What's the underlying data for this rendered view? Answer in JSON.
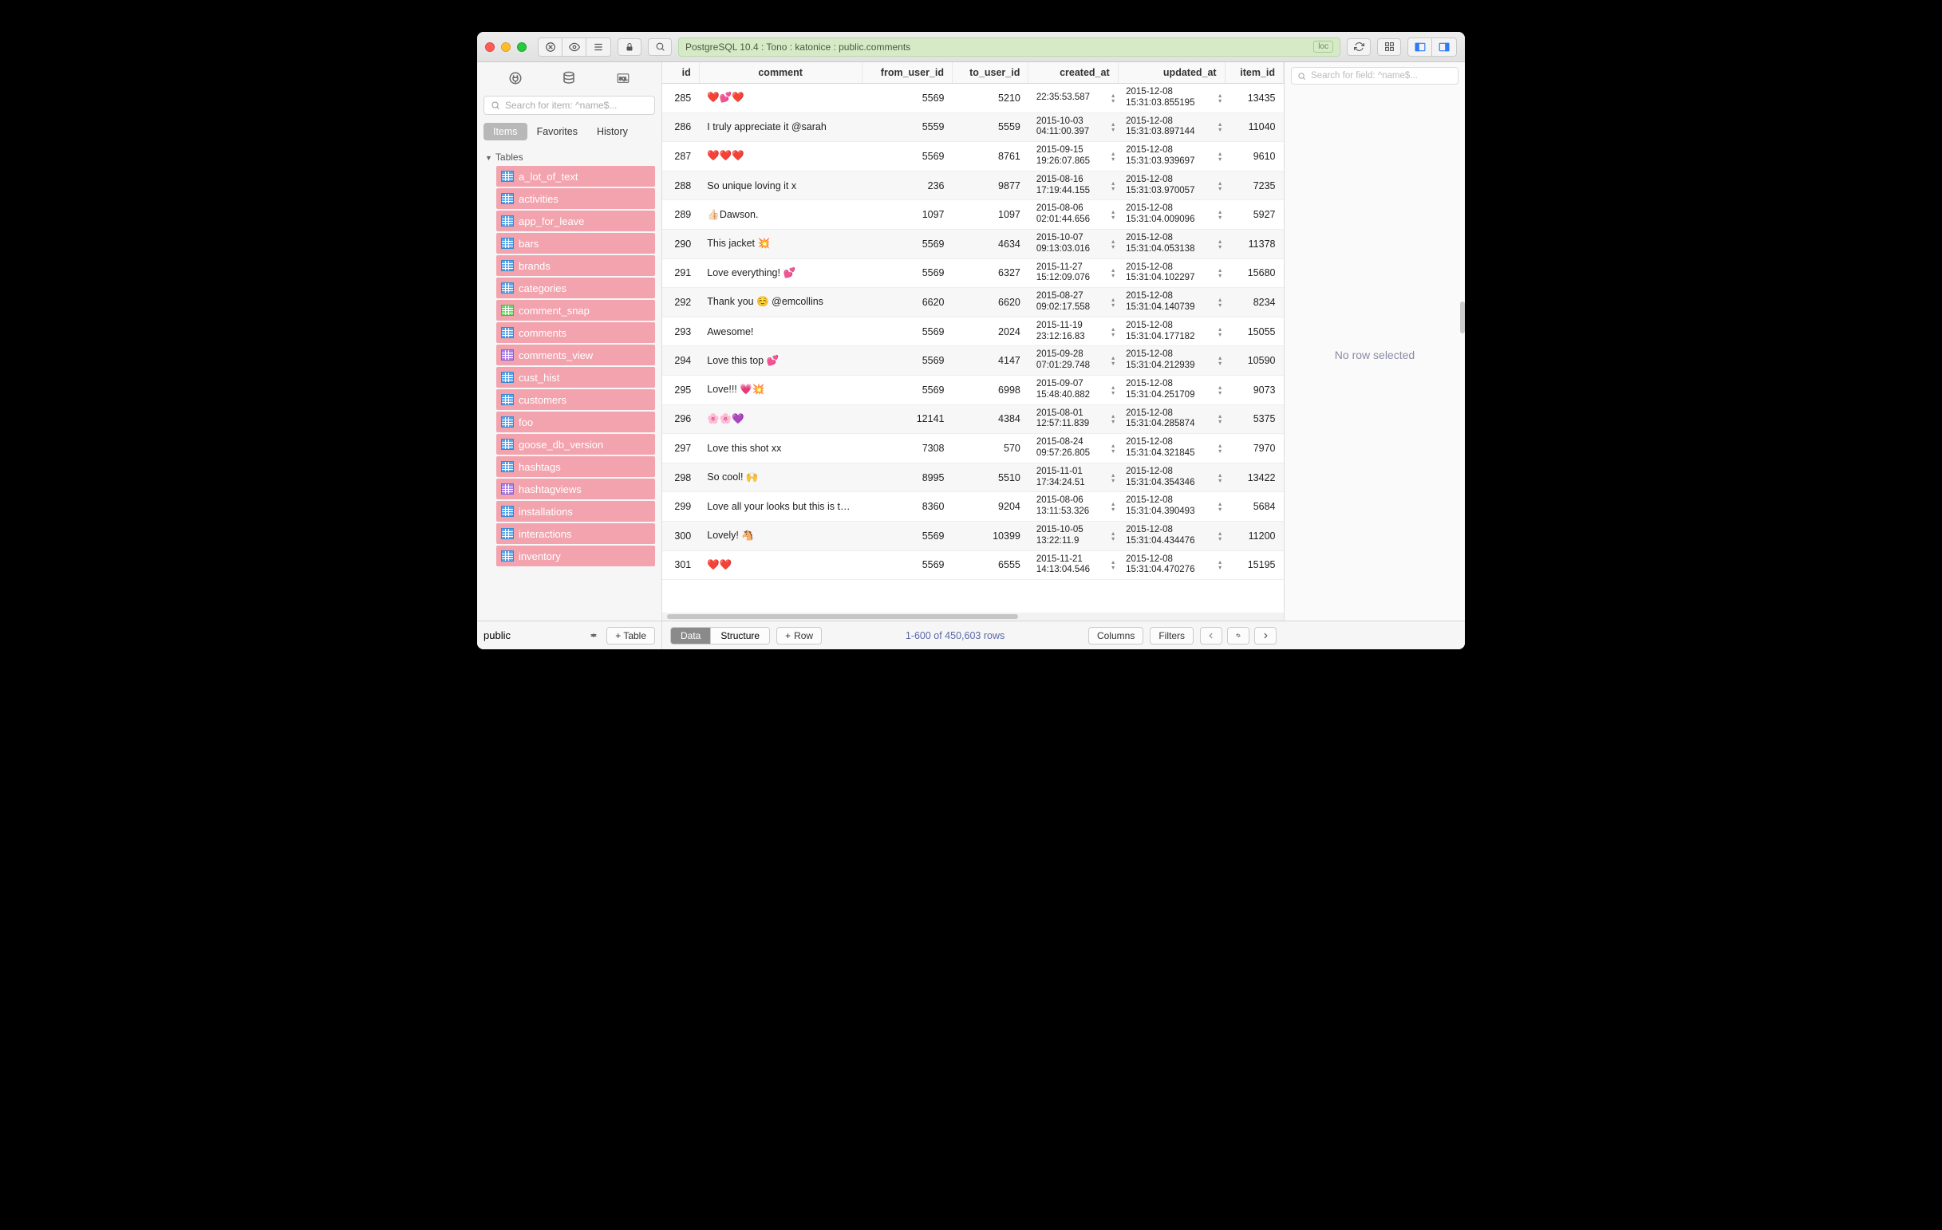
{
  "titlebar": {
    "breadcrumb": "PostgreSQL 10.4 : Tono : katonice : public.comments",
    "loc_badge": "loc"
  },
  "sidebar": {
    "search_placeholder": "Search for item: ^name$...",
    "tabs": {
      "items": "Items",
      "favorites": "Favorites",
      "history": "History"
    },
    "section": "Tables",
    "tables": [
      {
        "name": "a_lot_of_text",
        "kind": "table"
      },
      {
        "name": "activities",
        "kind": "table"
      },
      {
        "name": "app_for_leave",
        "kind": "table"
      },
      {
        "name": "bars",
        "kind": "table"
      },
      {
        "name": "brands",
        "kind": "table"
      },
      {
        "name": "categories",
        "kind": "table"
      },
      {
        "name": "comment_snap",
        "kind": "snap"
      },
      {
        "name": "comments",
        "kind": "table"
      },
      {
        "name": "comments_view",
        "kind": "view"
      },
      {
        "name": "cust_hist",
        "kind": "table"
      },
      {
        "name": "customers",
        "kind": "table"
      },
      {
        "name": "foo",
        "kind": "table"
      },
      {
        "name": "goose_db_version",
        "kind": "table"
      },
      {
        "name": "hashtags",
        "kind": "table"
      },
      {
        "name": "hashtagviews",
        "kind": "view"
      },
      {
        "name": "installations",
        "kind": "table"
      },
      {
        "name": "interactions",
        "kind": "table"
      },
      {
        "name": "inventory",
        "kind": "table"
      }
    ]
  },
  "grid": {
    "columns": [
      "id",
      "comment",
      "from_user_id",
      "to_user_id",
      "created_at",
      "updated_at",
      "item_id"
    ],
    "rows": [
      {
        "id": "285",
        "comment": "❤️💕❤️",
        "from": "5569",
        "to": "5210",
        "created": "\n22:35:53.587",
        "updated": "2015-12-08\n15:31:03.855195",
        "item": "13435"
      },
      {
        "id": "286",
        "comment": "I truly appreciate it @sarah",
        "from": "5559",
        "to": "5559",
        "created": "2015-10-03\n04:11:00.397",
        "updated": "2015-12-08\n15:31:03.897144",
        "item": "11040"
      },
      {
        "id": "287",
        "comment": "❤️❤️❤️",
        "from": "5569",
        "to": "8761",
        "created": "2015-09-15\n19:26:07.865",
        "updated": "2015-12-08\n15:31:03.939697",
        "item": "9610"
      },
      {
        "id": "288",
        "comment": "So unique loving it x",
        "from": "236",
        "to": "9877",
        "created": "2015-08-16\n17:19:44.155",
        "updated": "2015-12-08\n15:31:03.970057",
        "item": "7235"
      },
      {
        "id": "289",
        "comment": "👍🏻Dawson.",
        "from": "1097",
        "to": "1097",
        "created": "2015-08-06\n02:01:44.656",
        "updated": "2015-12-08\n15:31:04.009096",
        "item": "5927"
      },
      {
        "id": "290",
        "comment": "This jacket 💥",
        "from": "5569",
        "to": "4634",
        "created": "2015-10-07\n09:13:03.016",
        "updated": "2015-12-08\n15:31:04.053138",
        "item": "11378"
      },
      {
        "id": "291",
        "comment": "Love everything! 💕",
        "from": "5569",
        "to": "6327",
        "created": "2015-11-27\n15:12:09.076",
        "updated": "2015-12-08\n15:31:04.102297",
        "item": "15680"
      },
      {
        "id": "292",
        "comment": "Thank you ☺️ @emcollins",
        "from": "6620",
        "to": "6620",
        "created": "2015-08-27\n09:02:17.558",
        "updated": "2015-12-08\n15:31:04.140739",
        "item": "8234"
      },
      {
        "id": "293",
        "comment": "Awesome!",
        "from": "5569",
        "to": "2024",
        "created": "2015-11-19\n23:12:16.83",
        "updated": "2015-12-08\n15:31:04.177182",
        "item": "15055"
      },
      {
        "id": "294",
        "comment": "Love this top 💕",
        "from": "5569",
        "to": "4147",
        "created": "2015-09-28\n07:01:29.748",
        "updated": "2015-12-08\n15:31:04.212939",
        "item": "10590"
      },
      {
        "id": "295",
        "comment": "Love!!! 💗💥",
        "from": "5569",
        "to": "6998",
        "created": "2015-09-07\n15:48:40.882",
        "updated": "2015-12-08\n15:31:04.251709",
        "item": "9073"
      },
      {
        "id": "296",
        "comment": "🌸🌸💜",
        "from": "12141",
        "to": "4384",
        "created": "2015-08-01\n12:57:11.839",
        "updated": "2015-12-08\n15:31:04.285874",
        "item": "5375"
      },
      {
        "id": "297",
        "comment": "Love this shot xx",
        "from": "7308",
        "to": "570",
        "created": "2015-08-24\n09:57:26.805",
        "updated": "2015-12-08\n15:31:04.321845",
        "item": "7970"
      },
      {
        "id": "298",
        "comment": "So cool! 🙌",
        "from": "8995",
        "to": "5510",
        "created": "2015-11-01\n17:34:24.51",
        "updated": "2015-12-08\n15:31:04.354346",
        "item": "13422"
      },
      {
        "id": "299",
        "comment": "Love all your looks but this is the best look I've seen on t…",
        "from": "8360",
        "to": "9204",
        "created": "2015-08-06\n13:11:53.326",
        "updated": "2015-12-08\n15:31:04.390493",
        "item": "5684"
      },
      {
        "id": "300",
        "comment": "Lovely! 🐴",
        "from": "5569",
        "to": "10399",
        "created": "2015-10-05\n13:22:11.9",
        "updated": "2015-12-08\n15:31:04.434476",
        "item": "11200"
      },
      {
        "id": "301",
        "comment": "❤️❤️",
        "from": "5569",
        "to": "6555",
        "created": "2015-11-21\n14:13:04.546",
        "updated": "2015-12-08\n15:31:04.470276",
        "item": "15195"
      }
    ]
  },
  "inspector": {
    "search_placeholder": "Search for field: ^name$...",
    "empty": "No row selected"
  },
  "bottombar": {
    "schema": "public",
    "add_table": "+ Table",
    "data": "Data",
    "structure": "Structure",
    "add_row": "Row",
    "rowinfo": "1-600 of 450,603 rows",
    "columns": "Columns",
    "filters": "Filters"
  }
}
